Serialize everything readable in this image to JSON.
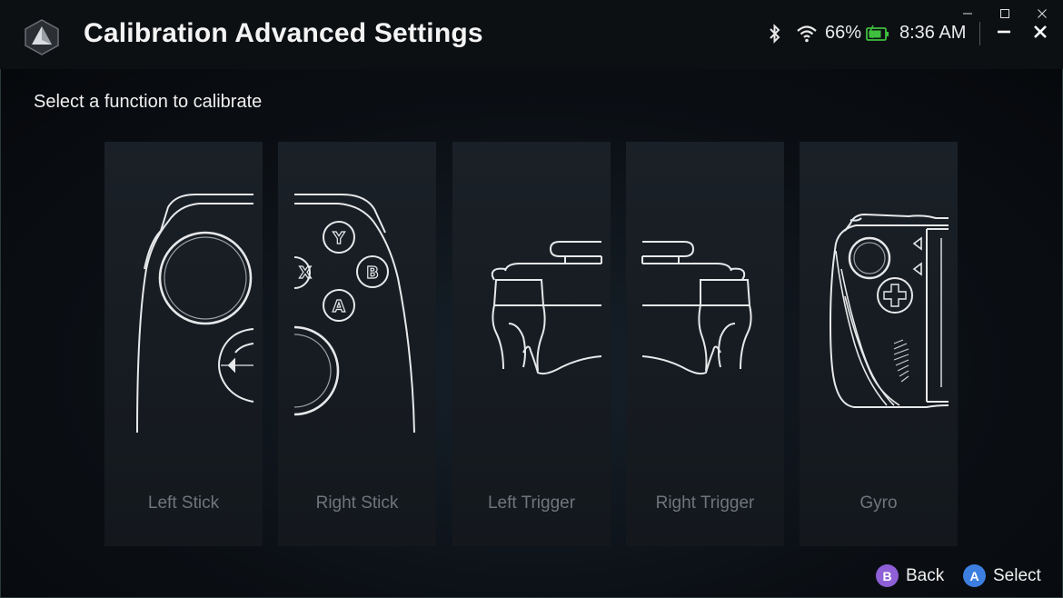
{
  "window": {
    "title": "Calibration Advanced Settings",
    "battery_percent": "66%",
    "time": "8:36 AM",
    "accent": "#3fbf3f"
  },
  "prompt": "Select a function to calibrate",
  "cards": [
    {
      "label": "Left Stick",
      "icon": "left-stick-illustration"
    },
    {
      "label": "Right Stick",
      "icon": "right-stick-illustration"
    },
    {
      "label": "Left Trigger",
      "icon": "left-trigger-illustration"
    },
    {
      "label": "Right Trigger",
      "icon": "right-trigger-illustration"
    },
    {
      "label": "Gyro",
      "icon": "gyro-illustration"
    }
  ],
  "footer": {
    "back_key": "B",
    "back_label": "Back",
    "back_color": "#8e5fd6",
    "select_key": "A",
    "select_label": "Select",
    "select_color": "#3c7fe0"
  }
}
